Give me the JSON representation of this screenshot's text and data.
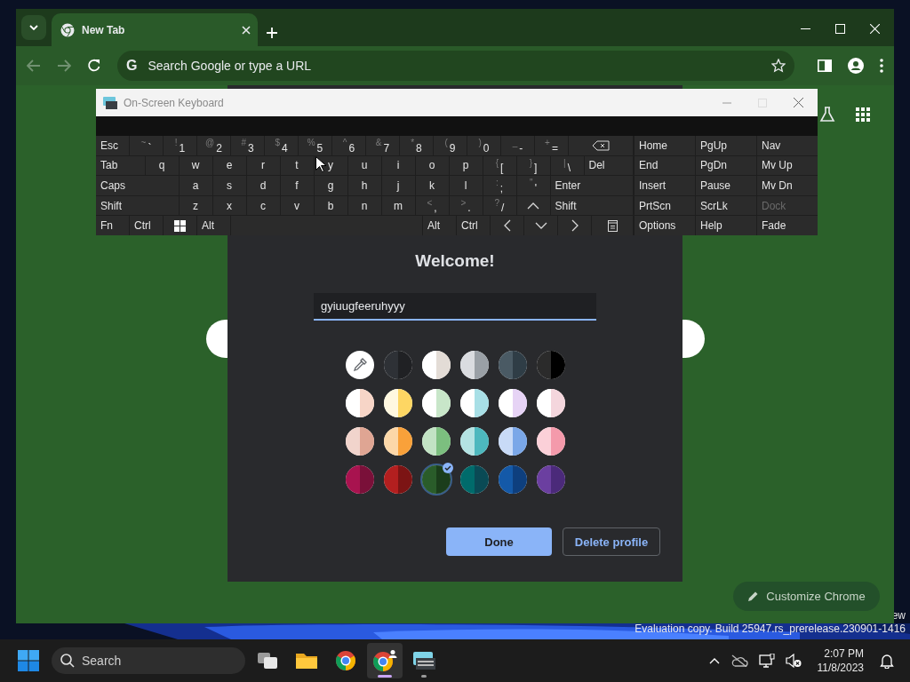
{
  "desktop": {
    "watermark": [
      "ew",
      "Evaluation copy. Build 25947.rs_prerelease.230901-1416"
    ]
  },
  "browser": {
    "tabs": [
      {
        "title": "New Tab",
        "selected": true
      }
    ],
    "nav_buttons": [
      {
        "kind": "back",
        "disabled": true
      },
      {
        "kind": "forward",
        "disabled": true
      },
      {
        "kind": "reload",
        "disabled": false
      }
    ],
    "omnibox": {
      "icon_text": "G",
      "placeholder": "Search Google or type a URL"
    },
    "customize_button": "Customize Chrome"
  },
  "profile_dialog": {
    "title": "Welcome!",
    "name_field": {
      "value": "gyiuugfeeruhyyy"
    },
    "swatches": [
      {
        "kind": "picker",
        "selected": false
      },
      {
        "kind": "color",
        "halves": [
          {
            "color": "#2e3136"
          },
          {
            "color": "#202124"
          }
        ],
        "selected": false
      },
      {
        "kind": "color",
        "halves": [
          {
            "color": "#ffffff"
          },
          {
            "color": "#e3dcd6"
          }
        ],
        "selected": false
      },
      {
        "kind": "color",
        "halves": [
          {
            "color": "#dadce0"
          },
          {
            "color": "#9aa0a6"
          }
        ],
        "selected": false
      },
      {
        "kind": "color",
        "halves": [
          {
            "color": "#4a5a64"
          },
          {
            "color": "#2f3d46"
          }
        ],
        "selected": false
      },
      {
        "kind": "color",
        "halves": [
          {
            "color": "#2b2b2b"
          },
          {
            "color": "#000000"
          }
        ],
        "selected": false
      },
      {
        "kind": "color",
        "halves": [
          {
            "color": "#ffffff"
          },
          {
            "color": "#f7d5c7"
          }
        ],
        "selected": false
      },
      {
        "kind": "color",
        "halves": [
          {
            "color": "#fff8e0"
          },
          {
            "color": "#fdd663"
          }
        ],
        "selected": false
      },
      {
        "kind": "color",
        "halves": [
          {
            "color": "#ffffff"
          },
          {
            "color": "#c8e6c9"
          }
        ],
        "selected": false
      },
      {
        "kind": "color",
        "halves": [
          {
            "color": "#ffffff"
          },
          {
            "color": "#a8dfe6"
          }
        ],
        "selected": false
      },
      {
        "kind": "color",
        "halves": [
          {
            "color": "#ffffff"
          },
          {
            "color": "#e6d3f5"
          }
        ],
        "selected": false
      },
      {
        "kind": "color",
        "halves": [
          {
            "color": "#ffffff"
          },
          {
            "color": "#f4d6dd"
          }
        ],
        "selected": false
      },
      {
        "kind": "color",
        "halves": [
          {
            "color": "#f1d4cc"
          },
          {
            "color": "#dfa593"
          }
        ],
        "selected": false
      },
      {
        "kind": "color",
        "halves": [
          {
            "color": "#fcd7a8"
          },
          {
            "color": "#f9a13a"
          }
        ],
        "selected": false
      },
      {
        "kind": "color",
        "halves": [
          {
            "color": "#c2e3c4"
          },
          {
            "color": "#7cbf7f"
          }
        ],
        "selected": false
      },
      {
        "kind": "color",
        "halves": [
          {
            "color": "#b4e3e3"
          },
          {
            "color": "#4db8be"
          }
        ],
        "selected": false
      },
      {
        "kind": "color",
        "halves": [
          {
            "color": "#c8daf7"
          },
          {
            "color": "#7aa7e8"
          }
        ],
        "selected": false
      },
      {
        "kind": "color",
        "halves": [
          {
            "color": "#fbd0d8"
          },
          {
            "color": "#f49aab"
          }
        ],
        "selected": false
      },
      {
        "kind": "color",
        "halves": [
          {
            "color": "#a8134f"
          },
          {
            "color": "#7a1039"
          }
        ],
        "selected": false
      },
      {
        "kind": "color",
        "halves": [
          {
            "color": "#b31f1f"
          },
          {
            "color": "#7c1414"
          }
        ],
        "selected": false
      },
      {
        "kind": "color",
        "halves": [
          {
            "color": "#2a5c2a"
          },
          {
            "color": "#1b3d1b"
          }
        ],
        "selected": true
      },
      {
        "kind": "color",
        "halves": [
          {
            "color": "#006b6b"
          },
          {
            "color": "#0a4a55"
          }
        ],
        "selected": false
      },
      {
        "kind": "color",
        "halves": [
          {
            "color": "#1459a8"
          },
          {
            "color": "#0e3f7e"
          }
        ],
        "selected": false
      },
      {
        "kind": "color",
        "halves": [
          {
            "color": "#6b3fa0"
          },
          {
            "color": "#4b2a7a"
          }
        ],
        "selected": false
      }
    ],
    "buttons": [
      {
        "label": "Done",
        "kind": "primary"
      },
      {
        "label": "Delete profile",
        "kind": "secondary"
      }
    ]
  },
  "keyboard": {
    "title": "On-Screen Keyboard",
    "rows": [
      {
        "keys": [
          {
            "label": "Esc",
            "kind": "key"
          },
          {
            "label": "`",
            "shift": "~",
            "kind": "key"
          },
          {
            "label": "1",
            "shift": "!",
            "kind": "key"
          },
          {
            "label": "2",
            "shift": "@",
            "kind": "key"
          },
          {
            "label": "3",
            "shift": "#",
            "kind": "key"
          },
          {
            "label": "4",
            "shift": "$",
            "kind": "key"
          },
          {
            "label": "5",
            "shift": "%",
            "kind": "key"
          },
          {
            "label": "6",
            "shift": "^",
            "kind": "key"
          },
          {
            "label": "7",
            "shift": "&",
            "kind": "key"
          },
          {
            "label": "8",
            "shift": "*",
            "kind": "key"
          },
          {
            "label": "9",
            "shift": "(",
            "kind": "key"
          },
          {
            "label": "0",
            "shift": ")",
            "kind": "key"
          },
          {
            "label": "-",
            "shift": "_",
            "kind": "key"
          },
          {
            "label": "=",
            "shift": "+",
            "kind": "key"
          },
          {
            "kind": "backspace"
          }
        ]
      },
      {
        "keys": [
          {
            "label": "Tab",
            "kind": "wide"
          },
          {
            "label": "q",
            "kind": "key"
          },
          {
            "label": "w",
            "kind": "key"
          },
          {
            "label": "e",
            "kind": "key"
          },
          {
            "label": "r",
            "kind": "key"
          },
          {
            "label": "t",
            "kind": "key"
          },
          {
            "label": "y",
            "kind": "key"
          },
          {
            "label": "u",
            "kind": "key"
          },
          {
            "label": "i",
            "kind": "key"
          },
          {
            "label": "o",
            "kind": "key"
          },
          {
            "label": "p",
            "kind": "key"
          },
          {
            "label": "[",
            "shift": "{",
            "kind": "key"
          },
          {
            "label": "]",
            "shift": "}",
            "kind": "key"
          },
          {
            "label": "\\",
            "shift": "|",
            "kind": "key"
          },
          {
            "label": "Del",
            "kind": "wide"
          }
        ]
      },
      {
        "keys": [
          {
            "label": "Caps",
            "kind": "wide"
          },
          {
            "label": "a",
            "kind": "key"
          },
          {
            "label": "s",
            "kind": "key"
          },
          {
            "label": "d",
            "kind": "key"
          },
          {
            "label": "f",
            "kind": "key"
          },
          {
            "label": "g",
            "kind": "key"
          },
          {
            "label": "h",
            "kind": "key"
          },
          {
            "label": "j",
            "kind": "key"
          },
          {
            "label": "k",
            "kind": "key"
          },
          {
            "label": "l",
            "kind": "key"
          },
          {
            "label": ";",
            "shift": ":",
            "kind": "key"
          },
          {
            "label": "'",
            "shift": "\"",
            "kind": "key"
          },
          {
            "label": "Enter",
            "kind": "wide"
          }
        ]
      },
      {
        "keys": [
          {
            "label": "Shift",
            "kind": "wide"
          },
          {
            "label": "z",
            "kind": "key"
          },
          {
            "label": "x",
            "kind": "key"
          },
          {
            "label": "c",
            "kind": "key"
          },
          {
            "label": "v",
            "kind": "key"
          },
          {
            "label": "b",
            "kind": "key"
          },
          {
            "label": "n",
            "kind": "key"
          },
          {
            "label": "m",
            "kind": "key"
          },
          {
            "label": ",",
            "shift": "<",
            "kind": "key"
          },
          {
            "label": ".",
            "shift": ">",
            "kind": "key"
          },
          {
            "label": "/",
            "shift": "?",
            "kind": "key"
          },
          {
            "kind": "up"
          },
          {
            "label": "Shift",
            "kind": "wide"
          }
        ]
      },
      {
        "keys": [
          {
            "label": "Fn",
            "kind": "key"
          },
          {
            "label": "Ctrl",
            "kind": "key"
          },
          {
            "kind": "windows"
          },
          {
            "label": "Alt",
            "kind": "key"
          },
          {
            "kind": "space"
          },
          {
            "label": "Alt",
            "kind": "key"
          },
          {
            "label": "Ctrl",
            "kind": "key"
          },
          {
            "kind": "left"
          },
          {
            "kind": "down"
          },
          {
            "kind": "right"
          },
          {
            "kind": "menu"
          }
        ]
      }
    ],
    "nav_keys": [
      {
        "label": "Home",
        "disabled": false
      },
      {
        "label": "PgUp",
        "disabled": false
      },
      {
        "label": "Nav",
        "disabled": false
      },
      {
        "label": "End",
        "disabled": false
      },
      {
        "label": "PgDn",
        "disabled": false
      },
      {
        "label": "Mv Up",
        "disabled": false
      },
      {
        "label": "Insert",
        "disabled": false
      },
      {
        "label": "Pause",
        "disabled": false
      },
      {
        "label": "Mv Dn",
        "disabled": false
      },
      {
        "label": "PrtScn",
        "disabled": false
      },
      {
        "label": "ScrLk",
        "disabled": false
      },
      {
        "label": "Dock",
        "disabled": true
      },
      {
        "label": "Options",
        "disabled": false
      },
      {
        "label": "Help",
        "disabled": false
      },
      {
        "label": "Fade",
        "disabled": false
      }
    ]
  },
  "taskbar": {
    "search": {
      "placeholder": "Search"
    },
    "apps": [
      {
        "kind": "task-view",
        "running": false,
        "selected": false
      },
      {
        "kind": "folder",
        "running": false,
        "selected": false
      },
      {
        "kind": "browser",
        "running": false,
        "selected": false
      },
      {
        "kind": "browser-profile",
        "running": true,
        "selected": true
      },
      {
        "kind": "keyboard",
        "running": true,
        "selected": false
      }
    ],
    "clock": {
      "time": "2:07 PM",
      "date": "11/8/2023"
    }
  }
}
